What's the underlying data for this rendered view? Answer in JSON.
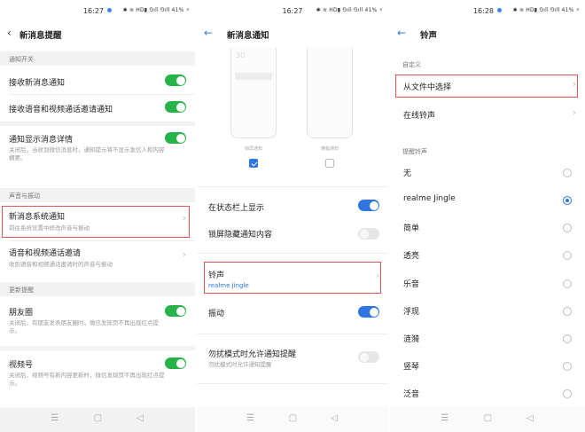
{
  "status": {
    "time1": "16:27",
    "time2": "16:27",
    "time3": "16:28",
    "indicators": "✱ ≋ HD▮ ⅁ıll ⅁ıll 41% ⚡"
  },
  "panel1": {
    "back": "‹",
    "title": "新消息提醒",
    "section_notify": "通知开关",
    "receive_new": "接收新消息通知",
    "receive_calls": "接收语音和视频通话邀请通知",
    "show_details": "通知显示消息详情",
    "show_details_sub": "关闭后，当收到微信消息时，通知提示将不显示发信人和内容摘要。",
    "section_sound": "声音与振动",
    "system_notify": "新消息系统通知",
    "system_notify_sub": "前往系统设置中修改声音与振动",
    "call_invite": "语音和视频通话邀请",
    "call_invite_sub": "收到语音和视频通话邀请时的声音与振动",
    "section_update": "更新提醒",
    "moments": "朋友圈",
    "moments_sub": "关闭后，有朋友发表朋友圈时，微信发现页不再出现红点提示。",
    "channels": "视频号",
    "channels_sub": "关闭后，视频号有新内容更新时，微信发现页不再出现红点提示。"
  },
  "panel2": {
    "back": "←",
    "title": "新消息通知",
    "preview_num": "30",
    "preview1": "锁屏通知",
    "preview2": "横幅通知",
    "statusbar_show": "在状态栏上显示",
    "lockscreen_hide": "锁屏隐藏通知内容",
    "ringtone": "铃声",
    "ringtone_value": "realme Jingle",
    "vibrate": "振动",
    "dnd": "勿扰模式时允许通知提醒",
    "dnd_sub": "勿扰模式时允许通知提醒"
  },
  "panel3": {
    "back": "←",
    "title": "铃声",
    "section_custom": "自定义",
    "from_file": "从文件中选择",
    "online": "在线铃声",
    "section_ringtones": "提醒铃声",
    "ringtones": [
      "无",
      "realme Jingle",
      "简单",
      "透亮",
      "乐音",
      "浮现",
      "涟漪",
      "竖琴",
      "泛音"
    ],
    "selected": "realme Jingle"
  },
  "nav": {
    "menu": "☰",
    "home": "▢",
    "back": "◁"
  },
  "colors": {
    "green_toggle": "#27b24a",
    "blue_toggle": "#2f75e1",
    "highlight_box": "#e05353",
    "link_blue": "#2f75e1"
  }
}
